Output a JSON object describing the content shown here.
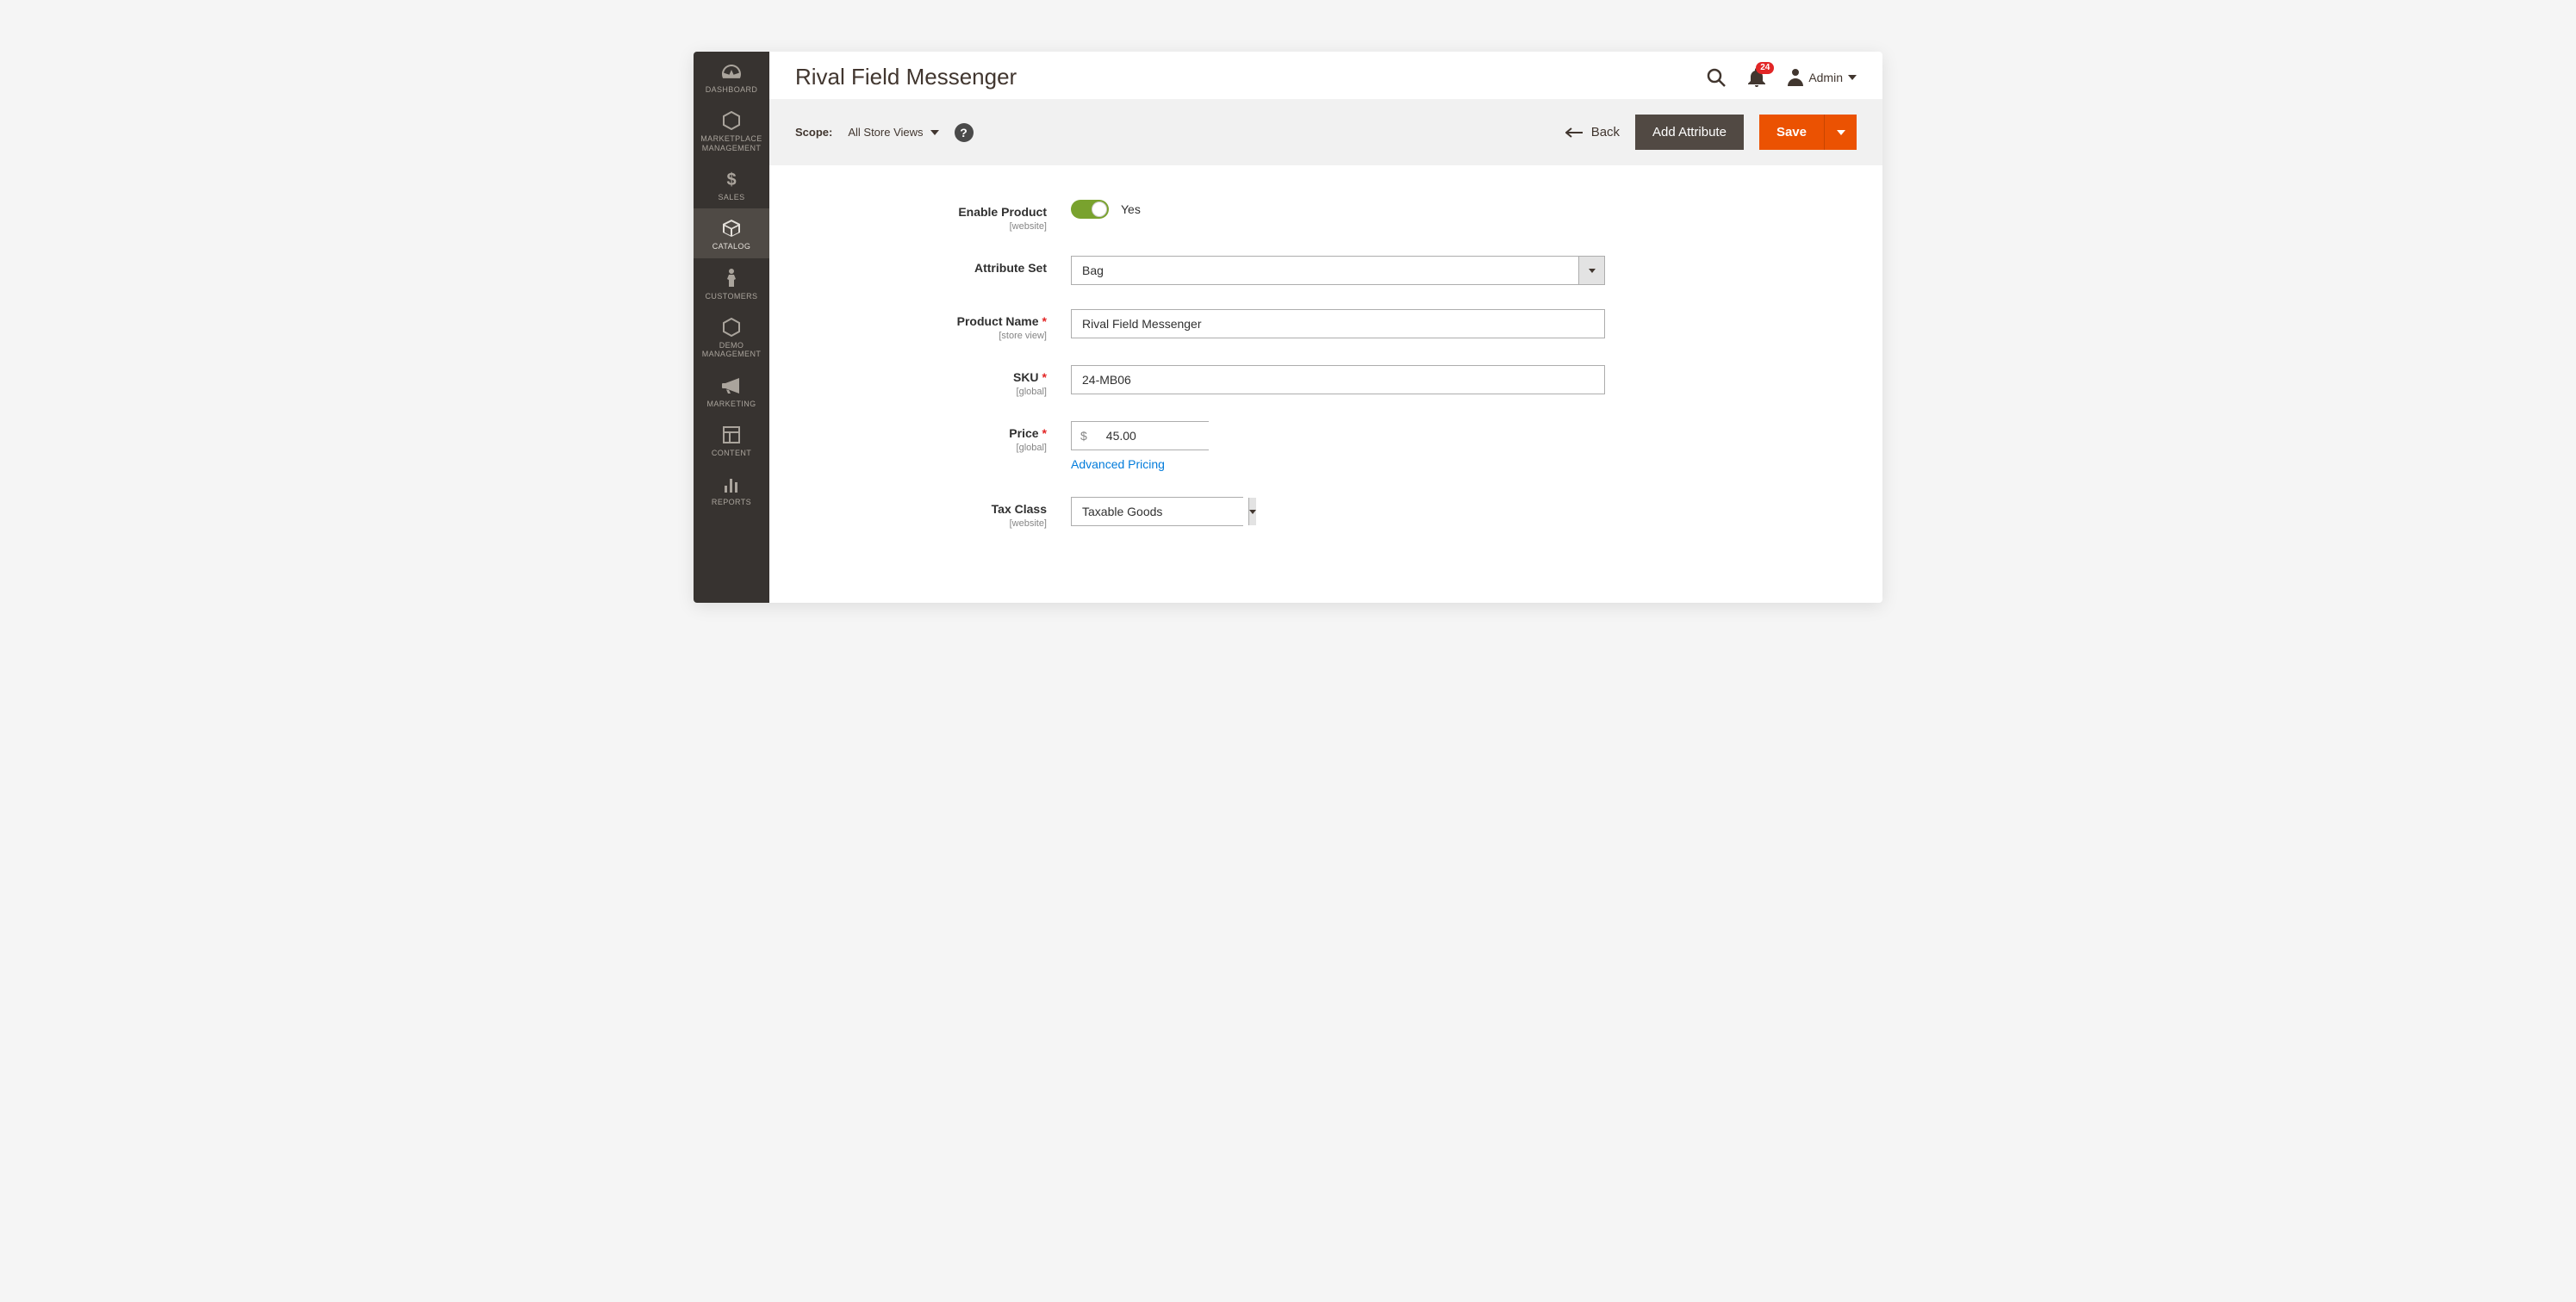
{
  "sidebar": {
    "items": [
      {
        "label": "DASHBOARD"
      },
      {
        "label": "MARKETPLACE MANAGEMENT"
      },
      {
        "label": "SALES"
      },
      {
        "label": "CATALOG"
      },
      {
        "label": "CUSTOMERS"
      },
      {
        "label": "DEMO MANAGEMENT"
      },
      {
        "label": "MARKETING"
      },
      {
        "label": "CONTENT"
      },
      {
        "label": "REPORTS"
      }
    ]
  },
  "header": {
    "title": "Rival Field Messenger",
    "notification_count": "24",
    "admin_label": "Admin"
  },
  "toolbar": {
    "scope_label": "Scope:",
    "scope_value": "All Store Views",
    "back_label": "Back",
    "add_attribute_label": "Add Attribute",
    "save_label": "Save"
  },
  "form": {
    "enable_product": {
      "label": "Enable Product",
      "sublabel": "[website]",
      "value_label": "Yes"
    },
    "attribute_set": {
      "label": "Attribute Set",
      "value": "Bag"
    },
    "product_name": {
      "label": "Product Name",
      "sublabel": "[store view]",
      "value": "Rival Field Messenger"
    },
    "sku": {
      "label": "SKU",
      "sublabel": "[global]",
      "value": "24-MB06"
    },
    "price": {
      "label": "Price",
      "sublabel": "[global]",
      "currency": "$",
      "value": "45.00",
      "advanced_link": "Advanced Pricing"
    },
    "tax_class": {
      "label": "Tax Class",
      "sublabel": "[website]",
      "value": "Taxable Goods"
    }
  }
}
